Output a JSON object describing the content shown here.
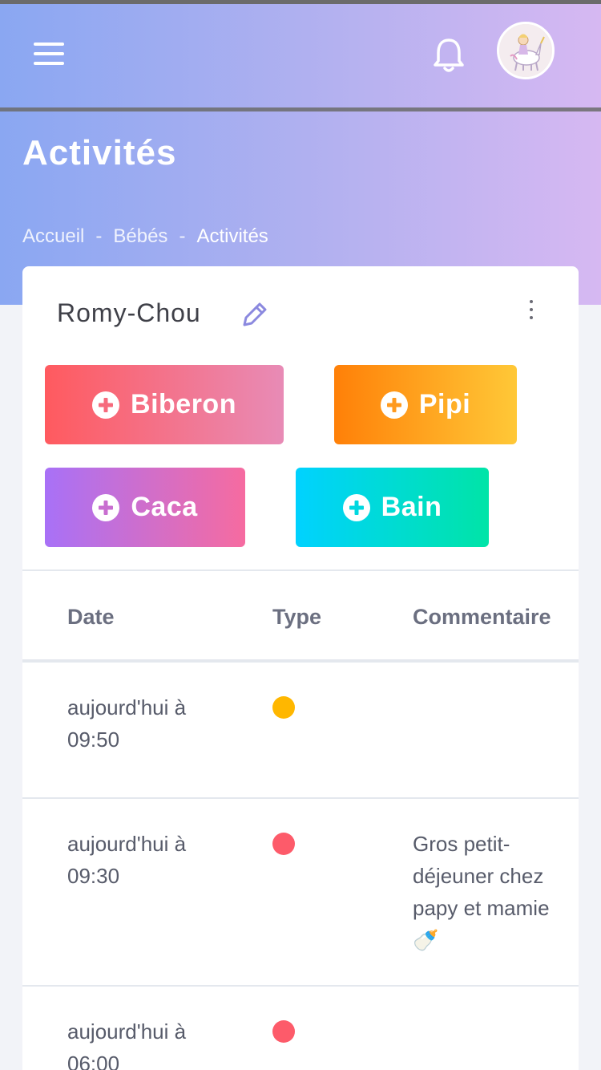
{
  "header": {
    "menu_icon": "hamburger-icon",
    "bell_icon": "bell-icon",
    "avatar_alt": "unicorn avatar"
  },
  "page": {
    "title": "Activités",
    "breadcrumb": [
      "Accueil",
      "Bébés",
      "Activités"
    ],
    "breadcrumb_sep": "-"
  },
  "card": {
    "baby_name": "Romy-Chou",
    "edit_icon": "pencil-icon",
    "more_icon": "more-vertical-icon",
    "buttons": [
      {
        "label": "Biberon",
        "icon": "plus-circle-icon"
      },
      {
        "label": "Pipi",
        "icon": "plus-circle-icon"
      },
      {
        "label": "Caca",
        "icon": "plus-circle-icon"
      },
      {
        "label": "Bain",
        "icon": "plus-circle-icon"
      }
    ]
  },
  "table": {
    "headers": [
      "Date",
      "Type",
      "Commentaire"
    ],
    "rows": [
      {
        "date": "aujourd'hui à 09:50",
        "type_color": "#ffb700",
        "comment": ""
      },
      {
        "date": "aujourd'hui à 09:30",
        "type_color": "#fd5b6a",
        "comment": "Gros petit-déjeuner chez papy et mamie 🍼"
      },
      {
        "date": "aujourd'hui à 06:00",
        "type_color": "#fd5b6a",
        "comment": ""
      }
    ]
  },
  "colors": {
    "header_gradient": [
      "#8aa7f2",
      "#d6b8f2"
    ],
    "biberon": "#ff5a5f",
    "pipi": "#ff8008",
    "caca": "#a871f7",
    "bain": "#00d2ff"
  }
}
